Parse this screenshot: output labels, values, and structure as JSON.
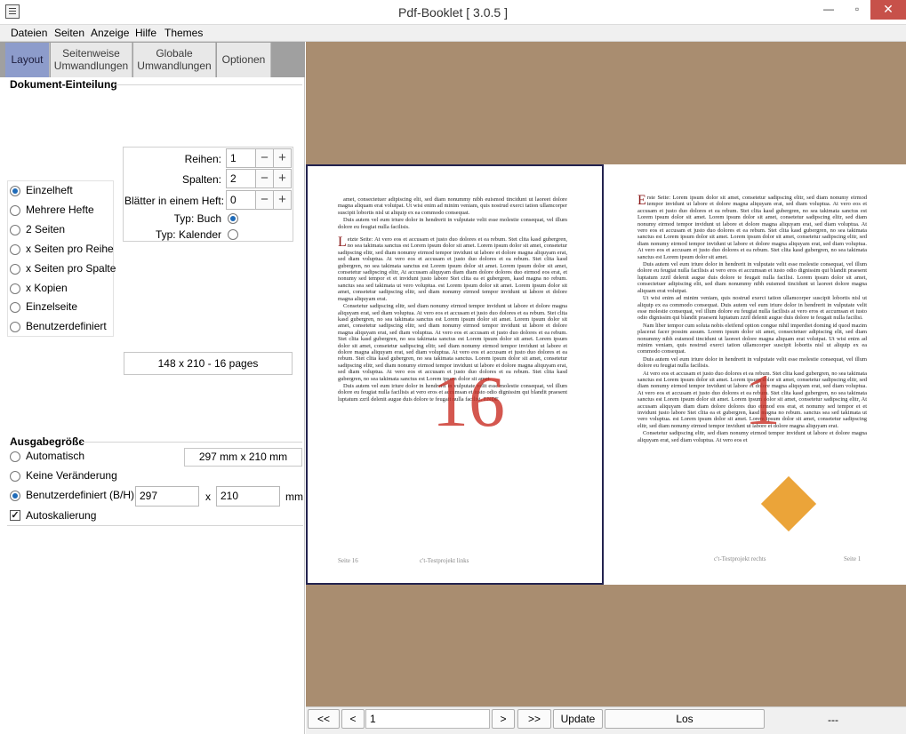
{
  "window": {
    "title": "Pdf-Booklet  [ 3.0.5 ]",
    "minimize": "—",
    "maximize": "▫",
    "close": "✕"
  },
  "menu": [
    "Dateien",
    "Seiten",
    "Anzeige",
    "Hilfe",
    "Themes"
  ],
  "tabs": [
    {
      "label": "Layout",
      "active": true
    },
    {
      "label": "Seitenweise\nUmwandlungen",
      "line1": "Seitenweise",
      "line2": "Umwandlungen"
    },
    {
      "label": "Globale\nUmwandlungen",
      "line1": "Globale",
      "line2": "Umwandlungen"
    },
    {
      "label": "Optionen"
    }
  ],
  "layout": {
    "section_title": "Dokument-Einteilung",
    "modes": [
      {
        "label": "Einzelheft",
        "selected": true
      },
      {
        "label": "Mehrere Hefte",
        "selected": false
      },
      {
        "label": "2 Seiten",
        "selected": false
      },
      {
        "label": "x Seiten pro Reihe",
        "selected": false
      },
      {
        "label": "x Seiten pro Spalte",
        "selected": false
      },
      {
        "label": "x Kopien",
        "selected": false
      },
      {
        "label": "Einzelseite",
        "selected": false
      },
      {
        "label": "Benutzerdefiniert",
        "selected": false
      }
    ],
    "rows_label": "Reihen:",
    "rows_value": "1",
    "cols_label": "Spalten:",
    "cols_value": "2",
    "sheets_label": "Blätter in einem Heft:",
    "sheets_value": "0",
    "type_book_label": "Typ: Buch",
    "type_book_selected": true,
    "type_calendar_label": "Typ: Kalender",
    "type_calendar_selected": false,
    "minus": "−",
    "plus": "+",
    "summary": "148 x 210 - 16 pages"
  },
  "output": {
    "section_title": "Ausgabegröße",
    "auto_label": "Automatisch",
    "auto_value": "297 mm x 210 mm",
    "nochange_label": "Keine Veränderung",
    "custom_label": "Benutzerdefiniert (B/H)",
    "custom_selected": true,
    "width": "297",
    "x_label": "x",
    "height": "210",
    "unit": "mm",
    "autoscale_label": "Autoskalierung",
    "autoscale_checked": true
  },
  "preview": {
    "left_page": {
      "number_overlay": "16",
      "footer_left": "Seite 16",
      "footer_right": "c't-Testprojekt links",
      "para1": "amet, consectetuer adipiscing elit, sed diam nonummy nibh euismod tincidunt ut laoreet dolore magna aliquam erat volutpat. Ut wisi enim ad minim veniam, quis nostrud exerci tation ullamcorper suscipit lobortis nisl ut aliquip ex ea commodo consequat.",
      "para2": "Duis autem vel eum iriure dolor in hendrerit in vulputate velit esse molestie consequat, vel illum dolore eu feugiat nulla facilisis.",
      "dropcap": "L",
      "para3": "etzte Seite: At vero eos et accusam et justo duo dolores et ea rebum. Stet clita kasd gubergren, no sea takimata sanctus est Lorem ipsum dolor sit amet. Lorem ipsum dolor sit amet, consetetur sadipscing elitr, sed diam nonumy eirmod tempor invidunt ut labore et dolore magna aliquyam erat, sed diam voluptua. At vero eos et accusam et justo duo dolores et ea rebum. Stet clita kasd gubergren, no sea takimata sanctus est Lorem ipsum dolor sit amet. Lorem ipsum dolor sit amet, consetetur sadipscing elitr, At accusam aliquyam diam diam dolore dolores duo eirmod eos erat, et nonumy sed tempor et et invidunt justo labore Stet clita ea et gubergren, kasd magna no rebum. sanctus sea sed takimata ut vero voluptua. est Lorem ipsum dolor sit amet. Lorem ipsum dolor sit amet, consetetur sadipscing elitr, sed diam nonumy eirmod tempor invidunt ut labore et dolore magna aliquyam erat.",
      "para4": "Consetetur sadipscing elitr, sed diam nonumy eirmod tempor invidunt ut labore et dolore magna aliquyam erat, sed diam voluptua. At vero eos et accusam et justo duo dolores et ea rebum. Stet clita kasd gubergren, no sea takimata sanctus est Lorem ipsum dolor sit amet. Lorem ipsum dolor sit amet, consetetur sadipscing elitr, sed diam nonumy eirmod tempor invidunt ut labore et dolore magna aliquyam erat, sed diam voluptua. At vero eos et accusam et justo duo dolores et ea rebum. Stet clita kasd gubergren, no sea takimata sanctus est Lorem ipsum dolor sit amet. Lorem ipsum dolor sit amet, consetetur sadipscing elitr, sed diam nonumy eirmod tempor invidunt ut labore et dolore magna aliquyam erat, sed diam voluptua. At vero eos et accusam et justo duo dolores et ea rebum. Stet clita kasd gubergren, no sea takimata sanctus. Lorem ipsum dolor sit amet, consetetur sadipscing elitr, sed diam nonumy eirmod tempor invidunt ut labore et dolore magna aliquyam erat, sed diam voluptua. At vero eos et accusam et justo duo dolores et ea rebum. Stet clita kasd gubergren, no sea takimata sanctus est Lorem ipsum dolor sit amet.",
      "para5": "Duis autem vel eum iriure dolor in hendrerit in vulputate velit esse molestie consequat, vel illum dolore eu feugiat nulla facilisis at vero eros et accumsan et iusto odio dignissim qui blandit praesent luptatum zzril delenit augue duis dolore te feugait nulla facilisi. ENDE"
    },
    "right_page": {
      "number_overlay": "1",
      "footer_left": "c't-Testprojekt rechts",
      "footer_right": "Seite 1",
      "dropcap": "E",
      "para1": "rste Seite: Lorem ipsum dolor sit amet, consetetur sadipscing elitr, sed diam nonumy eirmod tempor invidunt ut labore et dolore magna aliquyam erat, sed diam voluptua. At vero eos et accusam et justo duo dolores et ea rebum. Stet clita kasd gubergren, no sea takimata sanctus est Lorem ipsum dolor sit amet. Lorem ipsum dolor sit amet, consetetur sadipscing elitr, sed diam nonumy eirmod tempor invidunt ut labore et dolore magna aliquyam erat, sed diam voluptua. At vero eos et accusam et justo duo dolores et ea rebum. Stet clita kasd gubergren, no sea takimata sanctus est Lorem ipsum dolor sit amet. Lorem ipsum dolor sit amet, consetetur sadipscing elitr, sed diam nonumy eirmod tempor invidunt ut labore et dolore magna aliquyam erat, sed diam voluptua. At vero eos et accusam et justo duo dolores et ea rebum. Stet clita kasd gubergren, no sea takimata sanctus est Lorem ipsum dolor sit amet.",
      "para2": "Duis autem vel eum iriure dolor in hendrerit in vulputate velit esse molestie consequat, vel illum dolore eu feugiat nulla facilisis at vero eros et accumsan et iusto odio dignissim qui blandit praesent luptatum zzril delenit augue duis dolore te feugait nulla facilisi. Lorem ipsum dolor sit amet, consectetuer adipiscing elit, sed diam nonummy nibh euismod tincidunt ut laoreet dolore magna aliquam erat volutpat.",
      "para3": "Ut wisi enim ad minim veniam, quis nostrud exerci tation ullamcorper suscipit lobortis nisl ut aliquip ex ea commodo consequat. Duis autem vel eum iriure dolor in hendrerit in vulputate velit esse molestie consequat, vel illum dolore eu feugiat nulla facilisis at vero eros et accumsan et iusto odio dignissim qui blandit praesent luptatum zzril delenit augue duis dolore te feugait nulla facilisi.",
      "para4": "Nam liber tempor cum soluta nobis eleifend option congue nihil imperdiet doming id quod mazim placerat facer possim assum. Lorem ipsum dolor sit amet, consectetuer adipiscing elit, sed diam nonummy nibh euismod tincidunt ut laoreet dolore magna aliquam erat volutpat. Ut wisi enim ad minim veniam, quis nostrud exerci tation ullamcorper suscipit lobortis nisl ut aliquip ex ea commodo consequat.",
      "para5": "Duis autem vel eum iriure dolor in hendrerit in vulputate velit esse molestie consequat, vel illum dolore eu feugiat nulla facilisis.",
      "para6": "At vero eos et accusam et justo duo dolores et ea rebum. Stet clita kasd gubergren, no sea takimata sanctus est Lorem ipsum dolor sit amet. Lorem ipsum dolor sit amet, consetetur sadipscing elitr, sed diam nonumy eirmod tempor invidunt ut labore et dolore magna aliquyam erat, sed diam voluptua. At vero eos et accusam et justo duo dolores et ea rebum. Stet clita kasd gubergren, no sea takimata sanctus est Lorem ipsum dolor sit amet. Lorem ipsum dolor sit amet, consetetur sadipscing elitr, At accusam aliquyam diam diam dolore dolores duo eirmod eos erat, et nonumy sed tempor et et invidunt justo labore Stet clita ea et gubergren, kasd magna no rebum. sanctus sea sed takimata ut vero voluptua. est Lorem ipsum dolor sit amet. Lorem ipsum dolor sit amet, consetetur sadipscing elitr, sed diam nonumy eirmod tempor invidunt ut labore et dolore magna aliquyam erat.",
      "para7": "Consetetur sadipscing elitr, sed diam nonumy eirmod tempor invidunt ut labore et dolore magna aliquyam erat, sed diam voluptua. At vero eos et"
    }
  },
  "nav": {
    "first": "<<",
    "prev": "<",
    "page_value": "1",
    "next": ">",
    "last": ">>",
    "update": "Update",
    "go": "Los",
    "status": "---"
  },
  "colors": {
    "tab_active": "#8d9ccb",
    "preview_bg": "#a98d70",
    "page_number_overlay": "#c8281e",
    "radio_selected": "#1f6bb8",
    "close_button": "#c7514a"
  }
}
